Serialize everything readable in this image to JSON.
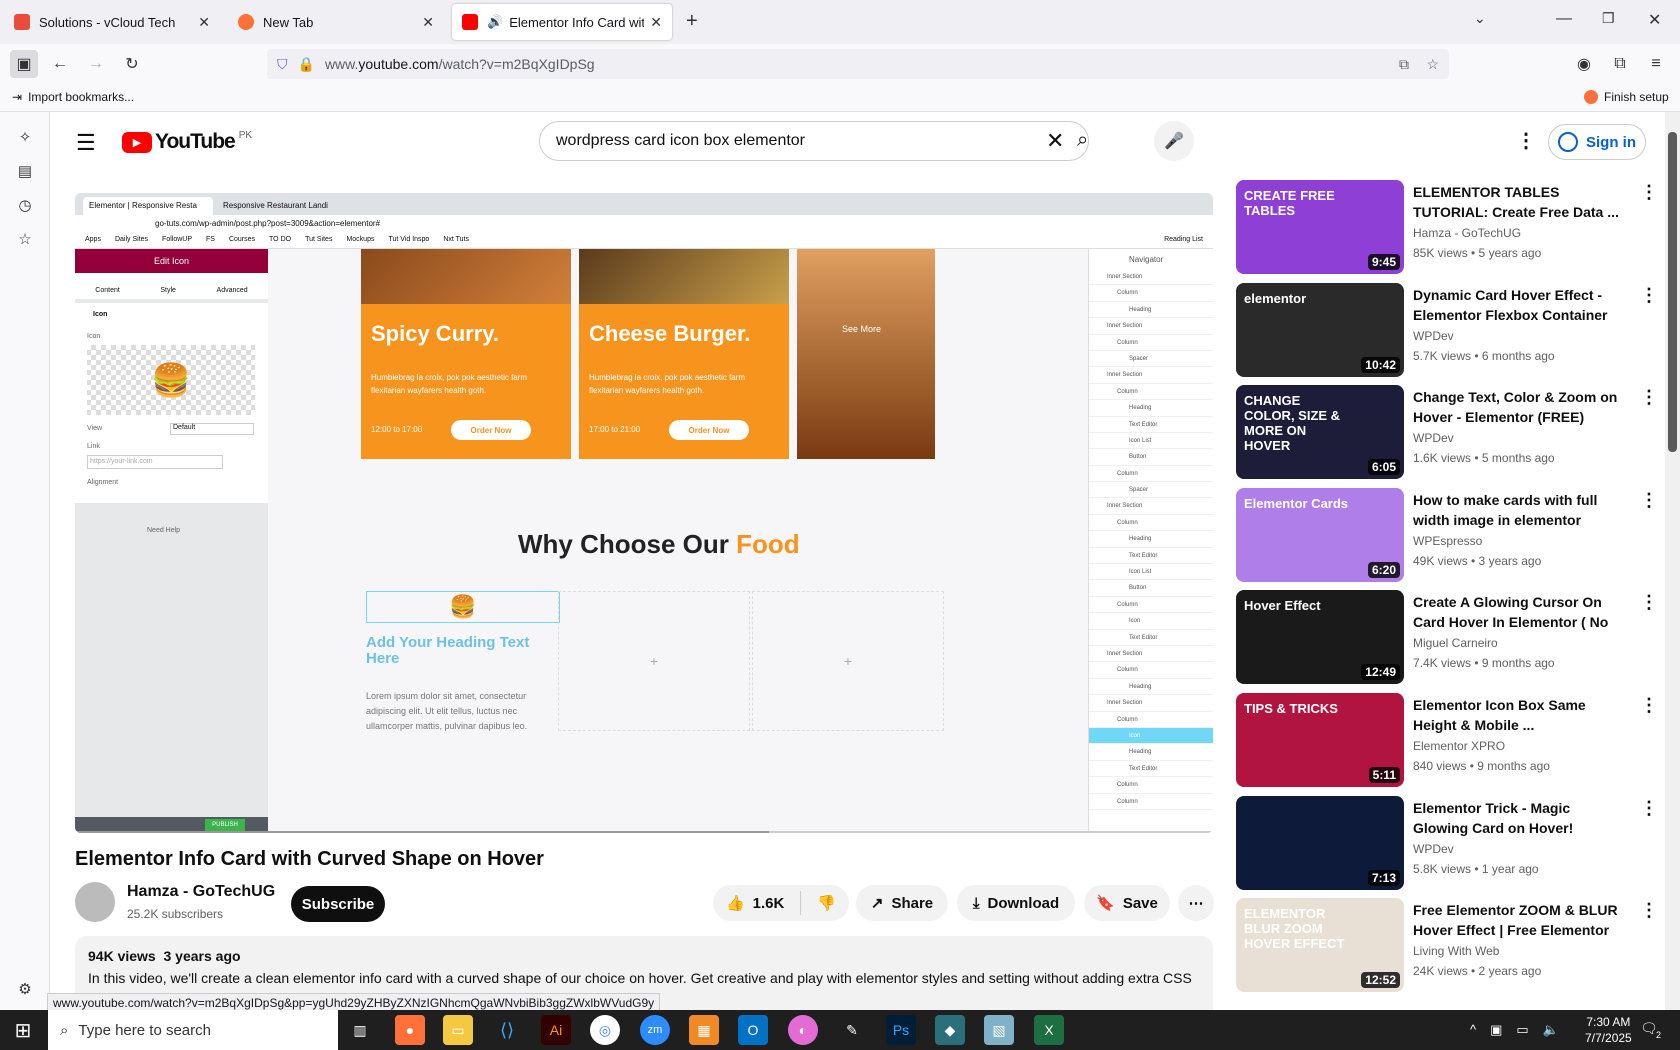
{
  "browser": {
    "tabs": [
      {
        "label": "Solutions - vCloud Tech",
        "color": "#e84c3d"
      },
      {
        "label": "New Tab",
        "color": "#ff7139"
      },
      {
        "label": "Elementor Info Card with Cu",
        "color": "#ff0000"
      }
    ],
    "url_prefix": "www.",
    "url_domain": "youtube.com",
    "url_path": "/watch?v=m2BqXgIDpSg",
    "bookmark": "Import bookmarks...",
    "finish_setup": "Finish setup",
    "status_url": "www.youtube.com/watch?v=m2BqXgIDpSg&pp=ygUhd29yZHByZXNzIGNhcmQgaWNvbiBib3ggZWxlbWVudG9y"
  },
  "youtube": {
    "logo_text": "YouTube",
    "region": "PK",
    "search_query": "wordpress card icon box elementor",
    "signin": "Sign in",
    "video_title": "Elementor Info Card with Curved Shape on Hover",
    "channel": "Hamza - GoTechUG",
    "subscribers": "25.2K subscribers",
    "subscribe": "Subscribe",
    "likes": "1.6K",
    "share": "Share",
    "download": "Download",
    "save": "Save",
    "views": "94K views",
    "age": "3 years ago",
    "description": "In this video, we'll create a clean elementor info card with a curved shape of our choice on hover. Get creative and play with elementor styles and setting without adding extra CSS"
  },
  "player": {
    "inner_tabs": [
      "Elementor | Responsive Resta",
      "Responsive Restaurant Landi"
    ],
    "inner_url": "go-tuts.com/wp-admin/post.php?post=3009&action=elementor#",
    "bookmarks": [
      "Apps",
      "Daily Sites",
      "FollowUP",
      "FS",
      "Courses",
      "TO DO",
      "Tut Sites",
      "Mockups",
      "Tut Vid Inspo",
      "Nxt Tuts"
    ],
    "reading_list": "Reading List",
    "panel_title": "Edit Icon",
    "panel_tabs": [
      "Content",
      "Style",
      "Advanced"
    ],
    "section": "Icon",
    "icon_label": "Icon",
    "view_label": "View",
    "view_value": "Default",
    "link_label": "Link",
    "link_placeholder": "https://your-link.com",
    "alignment_label": "Alignment",
    "need_help": "Need Help",
    "publish": "PUBLISH",
    "cards": [
      {
        "title": "Spicy Curry.",
        "text": "Humblebrag la croix, pok pok aesthetic farm flexitarian wayfarers health goth.",
        "time": "12:00 to 17:00",
        "button": "Order Now"
      },
      {
        "title": "Cheese Burger.",
        "text": "Humblebrag la croix, pok pok aesthetic farm flexitarian wayfarers health goth.",
        "time": "17:00 to 21:00",
        "button": "Order Now"
      }
    ],
    "see_more": "See More",
    "why_prefix": "Why Choose Our ",
    "why_accent": "Food",
    "heading_text": "Add Your Heading Text Here",
    "lorem": "Lorem ipsum dolor sit amet, consectetur adipiscing elit. Ut elit tellus, luctus nec ullamcorper mattis, pulvinar dapibus leo.",
    "navigator_title": "Navigator",
    "nav_items": [
      "Inner Section",
      "Column",
      "Heading",
      "Inner Section",
      "Column",
      "Spacer",
      "Inner Section",
      "Column",
      "Heading",
      "Text Editor",
      "Icon List",
      "Button",
      "Column",
      "Spacer",
      "Inner Section",
      "Column",
      "Heading",
      "Text Editor",
      "Icon List",
      "Button",
      "Column",
      "Icon",
      "Text Editor",
      "Inner Section",
      "Column",
      "Heading",
      "Inner Section",
      "Column",
      "Icon",
      "Heading",
      "Text Editor",
      "Column",
      "Column"
    ]
  },
  "recommendations": [
    {
      "title": "ELEMENTOR TABLES TUTORIAL: Create Free Data ...",
      "channel": "Hamza - GoTechUG",
      "meta": "85K views • 5 years ago",
      "duration": "9:45",
      "thumb_text": "CREATE FREE TABLES",
      "thumb_color": "#8e3fd6"
    },
    {
      "title": "Dynamic Card Hover Effect - Elementor Flexbox Container",
      "channel": "WPDev",
      "meta": "5.7K views • 6 months ago",
      "duration": "10:42",
      "thumb_text": "elementor",
      "thumb_color": "#2a2a2a"
    },
    {
      "title": "Change Text, Color & Zoom on Hover - Elementor (FREE)",
      "channel": "WPDev",
      "meta": "1.6K views • 5 months ago",
      "duration": "6:05",
      "thumb_text": "CHANGE COLOR, SIZE & MORE ON HOVER",
      "thumb_color": "#1d1d3a"
    },
    {
      "title": "How to make cards with full width image in elementor",
      "channel": "WPEspresso",
      "meta": "49K views • 3 years ago",
      "duration": "6:20",
      "thumb_text": "Elementor Cards",
      "thumb_color": "#b07ee8"
    },
    {
      "title": "Create A Glowing Cursor On Card Hover In Elementor ( No ...",
      "channel": "Miguel Carneiro",
      "meta": "7.4K views • 9 months ago",
      "duration": "12:49",
      "thumb_text": "Hover Effect",
      "thumb_color": "#1a1a1a"
    },
    {
      "title": "Elementor Icon Box Same Height & Mobile ...",
      "channel": "Elementor XPRO",
      "meta": "840 views • 9 months ago",
      "duration": "5:11",
      "thumb_text": "TIPS & TRICKS",
      "thumb_color": "#b0143f"
    },
    {
      "title": "Elementor Trick - Magic Glowing Card on Hover!",
      "channel": "WPDev",
      "meta": "5.8K views • 1 year ago",
      "duration": "7:13",
      "thumb_text": "",
      "thumb_color": "#0d1a3a"
    },
    {
      "title": "Free Elementor ZOOM & BLUR Hover Effect | Free Elementor ...",
      "channel": "Living With Web",
      "meta": "24K views • 2 years ago",
      "duration": "12:52",
      "thumb_text": "ELEMENTOR BLUR ZOOM HOVER EFFECT",
      "thumb_color": "#e8e0d4"
    }
  ],
  "taskbar": {
    "search_placeholder": "Type here to search",
    "time": "7:30 AM",
    "date": "7/7/2025",
    "notifications": "2"
  }
}
